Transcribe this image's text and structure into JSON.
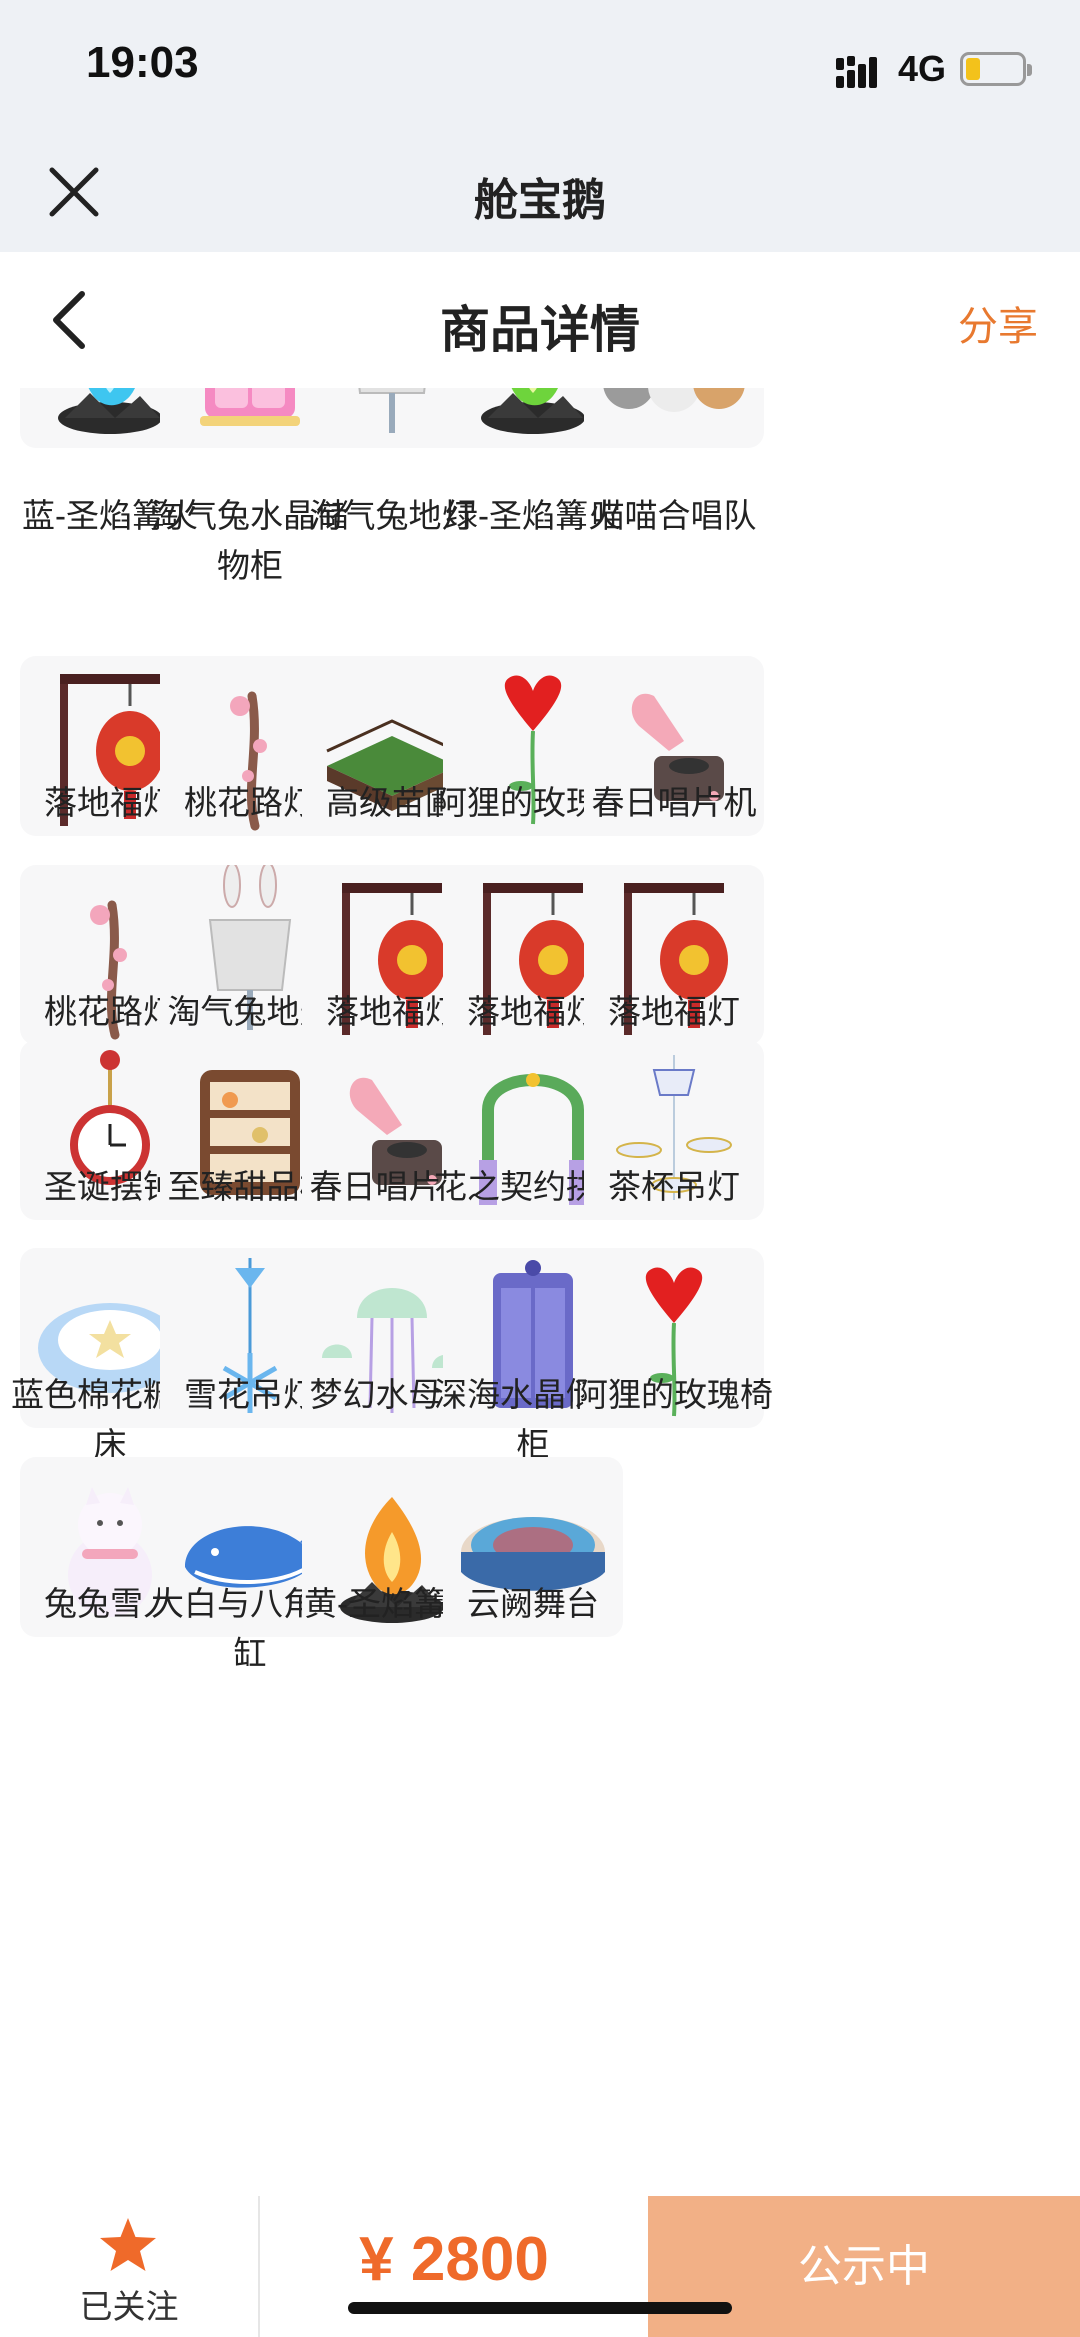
{
  "status_bar": {
    "time": "19:03",
    "network": "4G"
  },
  "app_bar": {
    "title": "舱宝鹅",
    "close_icon": "close-icon"
  },
  "nav_bar": {
    "title": "商品详情",
    "share_label": "分享",
    "back_icon": "chevron-left-icon"
  },
  "items": [
    {
      "label": "蓝-圣焰篝火",
      "icon": "bonfire-blue"
    },
    {
      "label": "淘气兔水晶储物柜",
      "icon": "cabinet-pink"
    },
    {
      "label": "淘气兔地灯",
      "icon": "bunny-lamp"
    },
    {
      "label": "绿-圣焰篝火",
      "icon": "bonfire-green"
    },
    {
      "label": "喵喵合唱队",
      "icon": "cats"
    },
    {
      "label": "落地福灯",
      "icon": "lantern"
    },
    {
      "label": "桃花路灯",
      "icon": "branch-lamp"
    },
    {
      "label": "高级苗圃",
      "icon": "garden"
    },
    {
      "label": "阿狸的玫瑰椅",
      "icon": "rose"
    },
    {
      "label": "春日唱片机",
      "icon": "gramophone"
    },
    {
      "label": "桃花路灯",
      "icon": "branch-lamp"
    },
    {
      "label": "淘气兔地灯",
      "icon": "bunny-lamp"
    },
    {
      "label": "落地福灯",
      "icon": "lantern"
    },
    {
      "label": "落地福灯",
      "icon": "lantern"
    },
    {
      "label": "落地福灯",
      "icon": "lantern"
    },
    {
      "label": "圣诞摆钟",
      "icon": "clock"
    },
    {
      "label": "至臻甜品柜",
      "icon": "dessert-cabinet"
    },
    {
      "label": "春日唱片机",
      "icon": "gramophone"
    },
    {
      "label": "花之契约拱门",
      "icon": "arch"
    },
    {
      "label": "茶杯吊灯",
      "icon": "teacup-lamp"
    },
    {
      "label": "蓝色棉花糖蹦床",
      "icon": "trampoline"
    },
    {
      "label": "雪花吊灯",
      "icon": "snowflake-lamp"
    },
    {
      "label": "梦幻水母灯",
      "icon": "jellyfish-lamp"
    },
    {
      "label": "深海水晶储物柜",
      "icon": "wardrobe-blue"
    },
    {
      "label": "阿狸的玫瑰椅",
      "icon": "rose"
    },
    {
      "label": "兔兔雪人",
      "icon": "snowman"
    },
    {
      "label": "大白与八角浴缸",
      "icon": "whale"
    },
    {
      "label": "黄-圣焰篝火",
      "icon": "bonfire-yellow"
    },
    {
      "label": "云阙舞台",
      "icon": "stage"
    }
  ],
  "bottom_bar": {
    "follow_label": "已关注",
    "price": "¥ 2800",
    "cta_label": "公示中",
    "accent": "#ef6a2a",
    "cta_bg": "#f2b086"
  }
}
